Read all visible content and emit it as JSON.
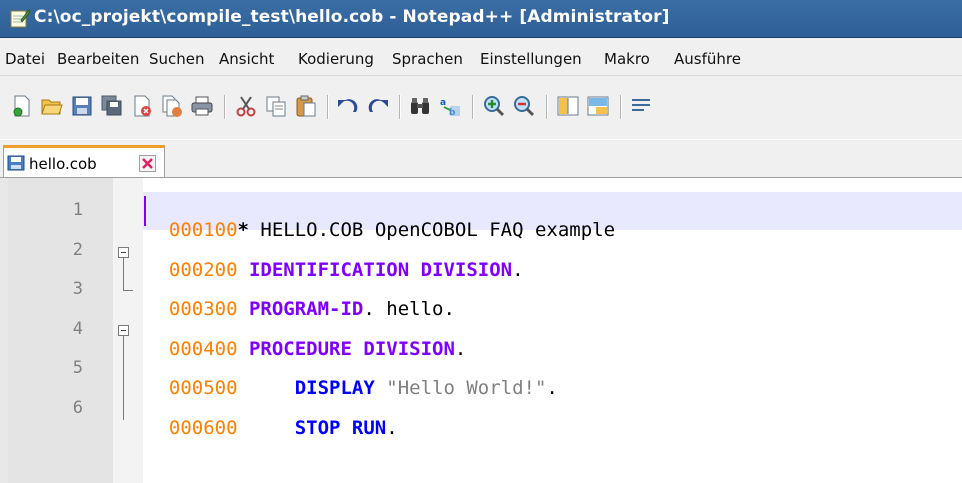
{
  "window": {
    "title": "C:\\oc_projekt\\compile_test\\hello.cob - Notepad++ [Administrator]"
  },
  "menu": [
    {
      "label": "Datei"
    },
    {
      "label": "Bearbeiten"
    },
    {
      "label": "Suchen"
    },
    {
      "label": "Ansicht"
    },
    {
      "label": "Kodierung"
    },
    {
      "label": "Sprachen"
    },
    {
      "label": "Einstellungen"
    },
    {
      "label": "Makro"
    },
    {
      "label": "Ausführe"
    }
  ],
  "toolbar": {
    "icons": [
      "new-file-icon",
      "open-file-icon",
      "save-icon",
      "save-all-icon",
      "close-icon",
      "close-all-icon",
      "print-icon",
      "cut-icon",
      "copy-icon",
      "paste-icon",
      "undo-icon",
      "redo-icon",
      "find-icon",
      "replace-icon",
      "zoom-in-icon",
      "zoom-out-icon",
      "sync-vertical-icon",
      "sync-horizontal-icon",
      "word-wrap-icon"
    ]
  },
  "tabs": [
    {
      "label": "hello.cob",
      "icon": "saved-file-icon",
      "active": true
    }
  ],
  "editor": {
    "lines": [
      {
        "num": "1",
        "seq": "000100",
        "parts": [
          {
            "t": "*",
            "c": "ast"
          },
          {
            "t": " HELLO.COB OpenCOBOL FAQ example",
            "c": ""
          }
        ]
      },
      {
        "num": "2",
        "seq": "000200",
        "parts": [
          {
            "t": " ",
            "c": ""
          },
          {
            "t": "IDENTIFICATION DIVISION",
            "c": "kw"
          },
          {
            "t": ".",
            "c": ""
          }
        ]
      },
      {
        "num": "3",
        "seq": "000300",
        "parts": [
          {
            "t": " ",
            "c": ""
          },
          {
            "t": "PROGRAM-ID",
            "c": "kw"
          },
          {
            "t": ". hello.",
            "c": ""
          }
        ]
      },
      {
        "num": "4",
        "seq": "000400",
        "parts": [
          {
            "t": " ",
            "c": ""
          },
          {
            "t": "PROCEDURE DIVISION",
            "c": "kw"
          },
          {
            "t": ".",
            "c": ""
          }
        ]
      },
      {
        "num": "5",
        "seq": "000500",
        "parts": [
          {
            "t": "     ",
            "c": ""
          },
          {
            "t": "DISPLAY",
            "c": "kw2"
          },
          {
            "t": " ",
            "c": ""
          },
          {
            "t": "\"Hello World!\"",
            "c": "str"
          },
          {
            "t": ".",
            "c": ""
          }
        ]
      },
      {
        "num": "6",
        "seq": "000600",
        "parts": [
          {
            "t": "     ",
            "c": ""
          },
          {
            "t": "STOP RUN",
            "c": "kw2"
          },
          {
            "t": ".",
            "c": ""
          }
        ]
      }
    ]
  },
  "colors": {
    "sequence": "#ff8000",
    "keyword": "#8000ff",
    "verb": "#0000ff",
    "string": "#808080",
    "current_line": "#e8e8ff"
  }
}
